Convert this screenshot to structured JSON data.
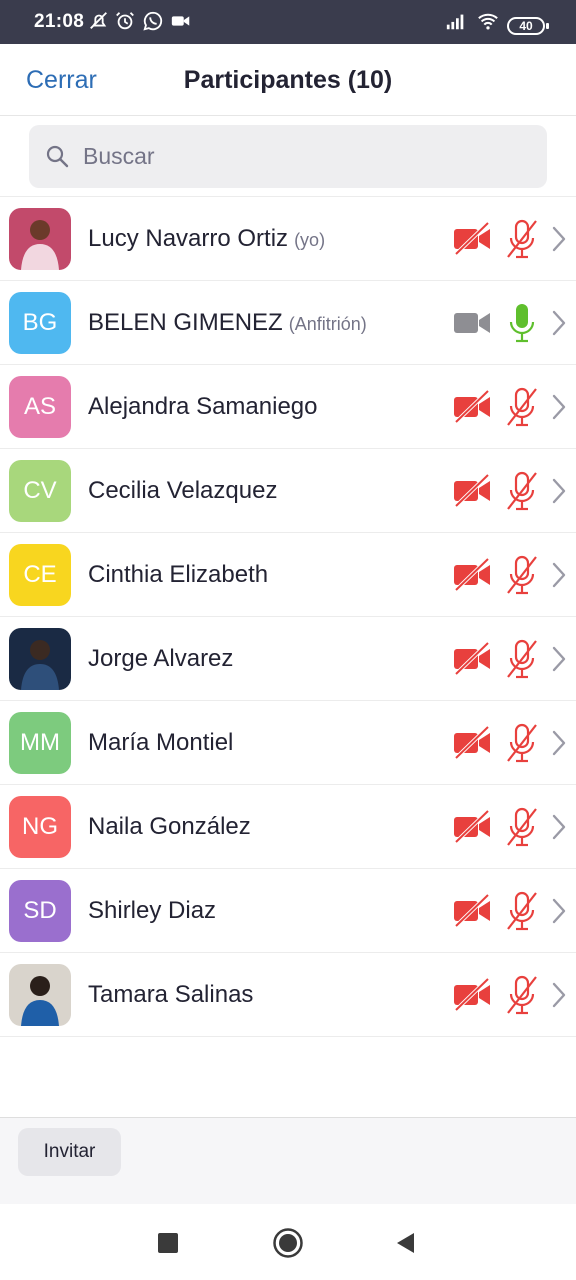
{
  "status_bar": {
    "time": "21:08",
    "battery": "40",
    "icons": [
      "muted-notifications-icon",
      "alarm-icon",
      "whatsapp-icon",
      "video-notification-icon",
      "signal-icon",
      "wifi-icon",
      "battery-icon"
    ]
  },
  "header": {
    "close_label": "Cerrar",
    "title": "Participantes (10)"
  },
  "search": {
    "placeholder": "Buscar",
    "value": ""
  },
  "participants": [
    {
      "name": "Lucy Navarro Ortiz",
      "role": "(yo)",
      "initials": "",
      "avatar": "photo",
      "video": "off",
      "mic": "muted"
    },
    {
      "name": "BELEN GIMENEZ",
      "role": "(Anfitrión)",
      "initials": "BG",
      "avatar_color": "#4fb8f0",
      "video": "inactive",
      "mic": "on"
    },
    {
      "name": "Alejandra Samaniego",
      "role": "",
      "initials": "AS",
      "avatar_color": "#e57cad",
      "video": "off",
      "mic": "muted"
    },
    {
      "name": "Cecilia Velazquez",
      "role": "",
      "initials": "CV",
      "avatar_color": "#a8d77c",
      "video": "off",
      "mic": "muted"
    },
    {
      "name": "Cinthia Elizabeth",
      "role": "",
      "initials": "CE",
      "avatar_color": "#f8d61f",
      "video": "off",
      "mic": "muted"
    },
    {
      "name": "Jorge Alvarez",
      "role": "",
      "initials": "",
      "avatar": "photo",
      "video": "off",
      "mic": "muted"
    },
    {
      "name": "María Montiel",
      "role": "",
      "initials": "MM",
      "avatar_color": "#7dcb7e",
      "video": "off",
      "mic": "muted"
    },
    {
      "name": "Naila González",
      "role": "",
      "initials": "NG",
      "avatar_color": "#f76565",
      "video": "off",
      "mic": "muted"
    },
    {
      "name": "Shirley Diaz",
      "role": "",
      "initials": "SD",
      "avatar_color": "#9a6fce",
      "video": "off",
      "mic": "muted"
    },
    {
      "name": "Tamara Salinas",
      "role": "",
      "initials": "",
      "avatar": "photo",
      "video": "off",
      "mic": "muted"
    }
  ],
  "colors": {
    "accent": "#2d6db5",
    "muted_red": "#e8403d",
    "mic_on_green": "#5fbf2d",
    "video_inactive_gray": "#8e8e93"
  },
  "footer": {
    "invite_label": "Invitar"
  },
  "nav_bar": {
    "buttons": [
      "recents-square-icon",
      "home-circle-icon",
      "back-triangle-icon"
    ]
  }
}
